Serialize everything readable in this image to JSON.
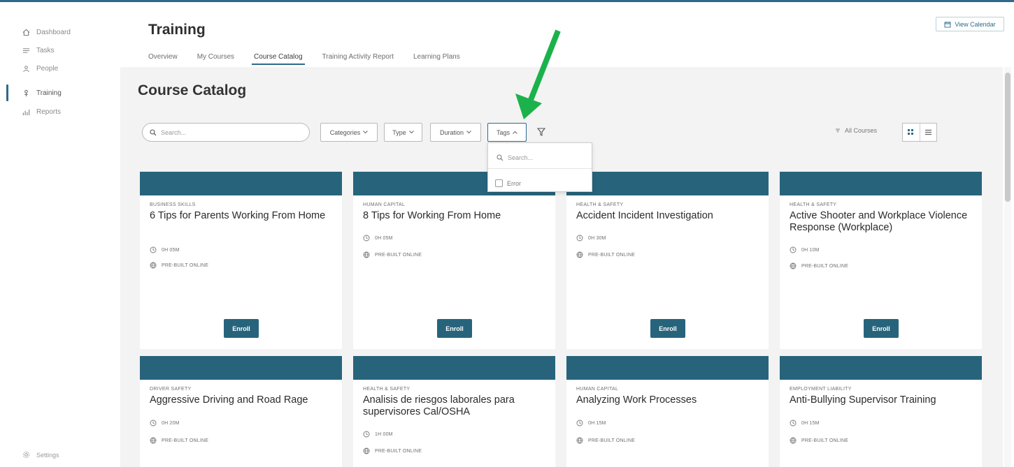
{
  "colors": {
    "accent": "#27647c",
    "arrow": "#1bb24b"
  },
  "sidebar": {
    "items": [
      {
        "label": "Dashboard",
        "icon": "home-icon"
      },
      {
        "label": "Tasks",
        "icon": "list-icon"
      },
      {
        "label": "People",
        "icon": "people-icon"
      },
      {
        "label": "Training",
        "icon": "training-icon",
        "active": true
      },
      {
        "label": "Reports",
        "icon": "chart-icon"
      }
    ],
    "settings_label": "Settings"
  },
  "header": {
    "title": "Training",
    "view_calendar": "View Calendar",
    "tabs": [
      {
        "label": "Overview"
      },
      {
        "label": "My Courses"
      },
      {
        "label": "Course Catalog",
        "active": true
      },
      {
        "label": "Training Activity Report"
      },
      {
        "label": "Learning Plans"
      }
    ]
  },
  "catalog": {
    "title": "Course Catalog",
    "search_placeholder": "Search...",
    "filters": {
      "categories": "Categories",
      "type": "Type",
      "duration": "Duration",
      "tags": "Tags"
    },
    "all_courses": "All Courses"
  },
  "tags_dropdown": {
    "search_placeholder": "Search...",
    "options": [
      "Error"
    ]
  },
  "cards": [
    {
      "category": "BUSINESS SKILLS",
      "title": "6 Tips for Parents Working From Home",
      "duration": "0H 05M",
      "format": "PRE-BUILT ONLINE",
      "enroll": "Enroll"
    },
    {
      "category": "HUMAN CAPITAL",
      "title": "8 Tips for Working From Home",
      "duration": "0H 05M",
      "format": "PRE-BUILT ONLINE",
      "enroll": "Enroll"
    },
    {
      "category": "HEALTH & SAFETY",
      "title": "Accident Incident Investigation",
      "duration": "0H 30M",
      "format": "PRE-BUILT ONLINE",
      "enroll": "Enroll"
    },
    {
      "category": "HEALTH & SAFETY",
      "title": "Active Shooter and Workplace Violence Response (Workplace)",
      "duration": "0H 10M",
      "format": "PRE-BUILT ONLINE",
      "enroll": "Enroll"
    },
    {
      "category": "DRIVER SAFETY",
      "title": "Aggressive Driving and Road Rage",
      "duration": "0H 20M",
      "format": "PRE-BUILT ONLINE"
    },
    {
      "category": "HEALTH & SAFETY",
      "title": "Analisis de riesgos laborales para supervisores Cal/OSHA",
      "duration": "1H 00M",
      "format": "PRE-BUILT ONLINE"
    },
    {
      "category": "HUMAN CAPITAL",
      "title": "Analyzing Work Processes",
      "duration": "0H 15M",
      "format": "PRE-BUILT ONLINE"
    },
    {
      "category": "EMPLOYMENT LIABILITY",
      "title": "Anti-Bullying Supervisor Training",
      "duration": "0H 15M",
      "format": "PRE-BUILT ONLINE"
    }
  ]
}
